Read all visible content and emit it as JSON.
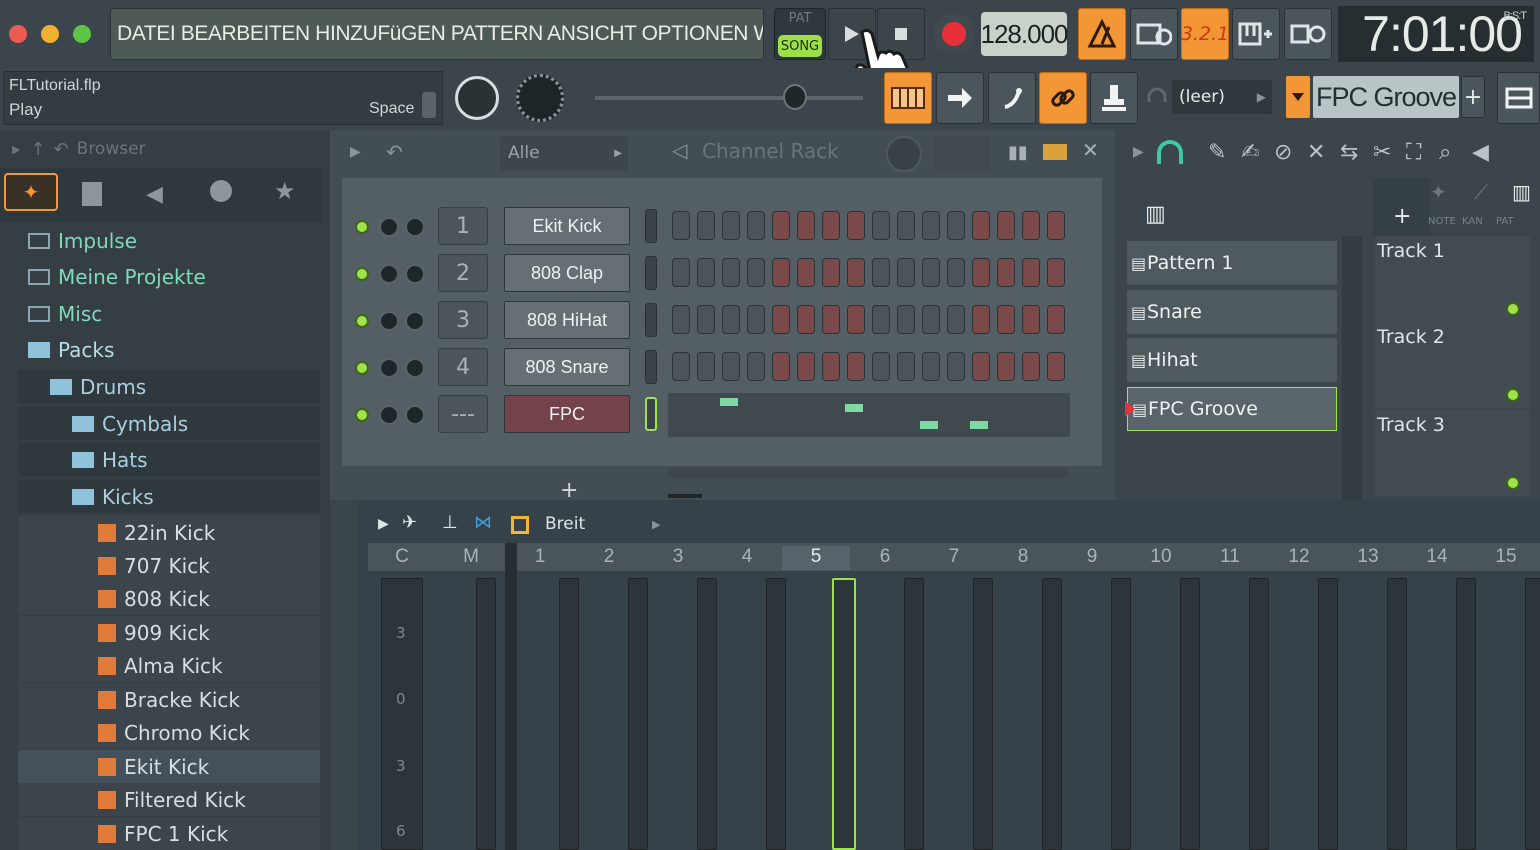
{
  "menu": {
    "text": "DATEI BEARBEITEN HINZUFüGEN PATTERN ANSICHT OPTIONEN WERKZEUGE HILFE"
  },
  "transport": {
    "pat_label": "PAT",
    "song_label": "SONG",
    "tempo": "128.000",
    "clock_label": "B:S:T",
    "clock": "7:01:00"
  },
  "hint": {
    "file": "FLTutorial.flp",
    "action": "Play",
    "shortcut": "Space"
  },
  "toolbar": {
    "pattern_select": "(leer)",
    "pattern_name": "FPC Groove",
    "add": "+"
  },
  "browser": {
    "title": "Browser",
    "items": [
      {
        "label": "Impulse",
        "level": 0,
        "icon": "folder-link-icon"
      },
      {
        "label": "Meine Projekte",
        "level": 0,
        "icon": "folder-link-icon"
      },
      {
        "label": "Misc",
        "level": 0,
        "icon": "folder-icon"
      },
      {
        "label": "Packs",
        "level": 0,
        "icon": "pack-icon"
      },
      {
        "label": "Drums",
        "level": 1,
        "icon": "pack-icon"
      },
      {
        "label": "Cymbals",
        "level": 2,
        "icon": "pack-icon"
      },
      {
        "label": "Hats",
        "level": 2,
        "icon": "pack-icon"
      },
      {
        "label": "Kicks",
        "level": 2,
        "icon": "pack-icon"
      },
      {
        "label": "22in Kick",
        "level": 3,
        "icon": "sample-icon"
      },
      {
        "label": "707 Kick",
        "level": 3,
        "icon": "sample-icon"
      },
      {
        "label": "808 Kick",
        "level": 3,
        "icon": "sample-icon"
      },
      {
        "label": "909 Kick",
        "level": 3,
        "icon": "sample-icon"
      },
      {
        "label": "Alma Kick",
        "level": 3,
        "icon": "sample-icon"
      },
      {
        "label": "Bracke Kick",
        "level": 3,
        "icon": "sample-icon"
      },
      {
        "label": "Chromo Kick",
        "level": 3,
        "icon": "sample-icon"
      },
      {
        "label": "Ekit Kick",
        "level": 3,
        "icon": "sample-icon",
        "selected": true
      },
      {
        "label": "Filtered Kick",
        "level": 3,
        "icon": "sample-icon"
      },
      {
        "label": "FPC 1 Kick",
        "level": 3,
        "icon": "sample-icon"
      }
    ]
  },
  "channel_rack": {
    "title": "Channel Rack",
    "filter": "Alle",
    "add": "+",
    "channels": [
      {
        "num": "1",
        "name": "Ekit Kick"
      },
      {
        "num": "2",
        "name": "808 Clap"
      },
      {
        "num": "3",
        "name": "808 HiHat"
      },
      {
        "num": "4",
        "name": "808 Snare"
      },
      {
        "num": "---",
        "name": "FPC"
      }
    ]
  },
  "patterns": {
    "tabs": [
      "NOTE",
      "KAN",
      "PAT"
    ],
    "items": [
      "Pattern 1",
      "Snare",
      "Hihat",
      "FPC Groove"
    ],
    "tracks": [
      "Track 1",
      "Track 2",
      "Track 3"
    ]
  },
  "mixer": {
    "snap": "Breit",
    "columns": [
      "C",
      "M",
      "1",
      "2",
      "3",
      "4",
      "5",
      "6",
      "7",
      "8",
      "9",
      "10",
      "11",
      "12",
      "13",
      "14",
      "15"
    ],
    "scale": [
      "3",
      "0",
      "3",
      "6"
    ]
  },
  "colors": {
    "accent": "#f29636",
    "led": "#9fe34a",
    "record": "#e8303a",
    "step_on": "#7a4a4a",
    "step_off": "#4b5559"
  }
}
